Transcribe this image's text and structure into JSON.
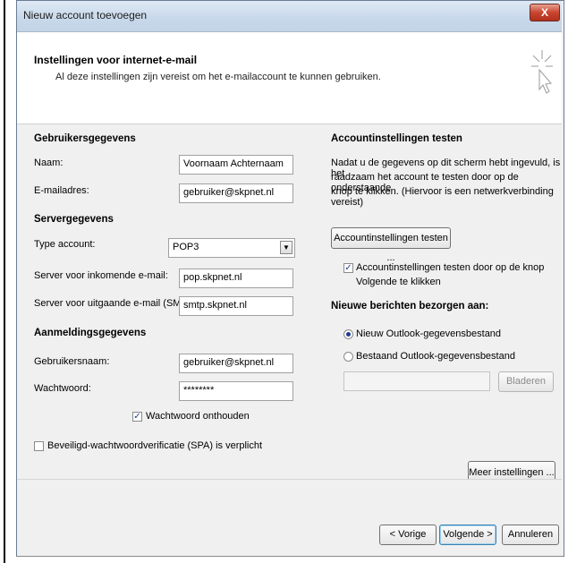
{
  "window": {
    "title": "Nieuw account toevoegen",
    "close_label": "X"
  },
  "header": {
    "title": "Instellingen voor internet-e-mail",
    "subtitle": "Al deze instellingen zijn vereist om het e-mailaccount te kunnen gebruiken."
  },
  "user": {
    "section": "Gebruikersgegevens",
    "name_label": "Naam:",
    "name_value": "Voornaam Achternaam",
    "email_label": "E-mailadres:",
    "email_value": "gebruiker@skpnet.nl"
  },
  "server": {
    "section": "Servergegevens",
    "type_label": "Type account:",
    "type_value": "POP3",
    "incoming_label": "Server voor inkomende e-mail:",
    "incoming_value": "pop.skpnet.nl",
    "outgoing_label": "Server voor uitgaande e-mail (SMTP):",
    "outgoing_value": "smtp.skpnet.nl"
  },
  "login": {
    "section": "Aanmeldingsgegevens",
    "username_label": "Gebruikersnaam:",
    "username_value": "gebruiker@skpnet.nl",
    "password_label": "Wachtwoord:",
    "password_value": "********",
    "remember_label": "Wachtwoord onthouden",
    "remember_checked": true,
    "spa_label": "Beveiligd-wachtwoordverificatie (SPA) is verplicht",
    "spa_checked": false
  },
  "test": {
    "section": "Accountinstellingen testen",
    "desc1": "Nadat u de gegevens op dit scherm hebt ingevuld, is het",
    "desc2": "raadzaam het account te testen door op de onderstaande",
    "desc3": "knop te klikken. (Hiervoor is een netwerkverbinding vereist)",
    "button": "Accountinstellingen testen ...",
    "auto_label1": "Accountinstellingen testen door op de knop",
    "auto_label2": "Volgende te klikken",
    "auto_checked": true
  },
  "deliver": {
    "section": "Nieuwe berichten bezorgen aan:",
    "opt_new": "Nieuw Outlook-gegevensbestand",
    "opt_existing": "Bestaand Outlook-gegevensbestand",
    "selected": "new",
    "path_value": "",
    "browse": "Bladeren"
  },
  "more_settings": "Meer instellingen ...",
  "footer": {
    "back": "< Vorige",
    "next": "Volgende >",
    "cancel": "Annuleren"
  }
}
